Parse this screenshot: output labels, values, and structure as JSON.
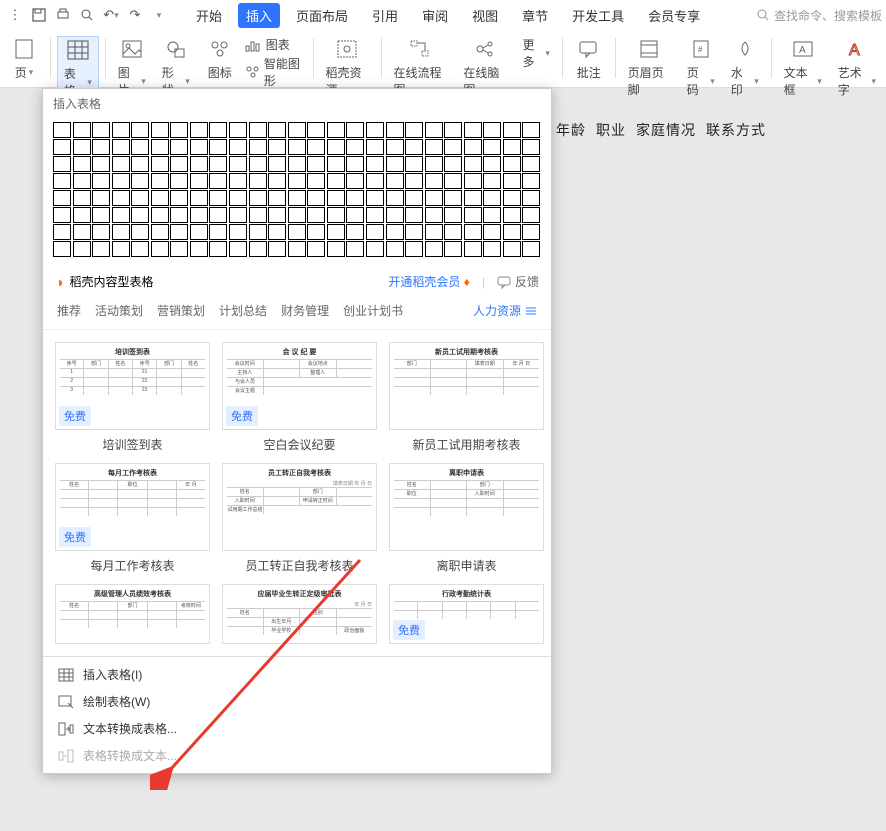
{
  "tabs": {
    "start": "开始",
    "insert": "插入",
    "layout": "页面布局",
    "ref": "引用",
    "review": "审阅",
    "view": "视图",
    "chapter": "章节",
    "dev": "开发工具",
    "member": "会员专享"
  },
  "search_placeholder": "查找命令、搜索模板",
  "ribbon": {
    "page_section": "页 ",
    "table": "表格",
    "picture": "图片",
    "shape": "形状",
    "icon": "图标",
    "chart": "图表",
    "smart": "智能图形",
    "docer_res": "稻壳资源",
    "flow": "在线流程图",
    "mind": "在线脑图",
    "more": "更多",
    "comment": "批注",
    "headerfooter": "页眉页脚",
    "pagenum": "页码",
    "watermark": "水印",
    "textbox": "文本框",
    "wordart": "艺术字"
  },
  "doc_header_cells": [
    "年龄",
    "职业",
    "家庭情况",
    "联系方式"
  ],
  "dropdown": {
    "header": "插入表格",
    "docer_label": "稻壳内容型表格",
    "open_member": "开通稻壳会员",
    "feedback": "反馈",
    "categories": [
      "推荐",
      "活动策划",
      "营销策划",
      "计划总结",
      "财务管理",
      "创业计划书"
    ],
    "cat_right": "人力资源",
    "free": "免费",
    "templates": {
      "r1c1": "培训签到表",
      "r1c2": "空白会议纪要",
      "r1c3": "新员工试用期考核表",
      "r2c1": "每月工作考核表",
      "r2c2": "员工转正自我考核表",
      "r2c3": "离职申请表",
      "r3c1_thumb": "高级管理人员绩效考核表",
      "r3c2_thumb": "应届毕业生转正定级审批表",
      "r3c3_thumb": "行政考勤统计表"
    },
    "thumb_labels": {
      "t1": "培训签到表",
      "t2": "会 议 纪 要",
      "t2_r1a": "会议时间",
      "t2_r1b": "会议地点",
      "t2_r2a": "主持人",
      "t2_r2b": "整理人",
      "t2_r3a": "与会人员",
      "t2_r4a": "会议主题",
      "t3": "新员工试用期考核表",
      "t4": "每月工作考核表",
      "t5": "员工转正自我考核表",
      "t6": "离职申请表"
    },
    "menu": {
      "insert_table": "插入表格(I)",
      "draw_table": "绘制表格(W)",
      "text_to_table": "文本转换成表格...",
      "table_to_text": "表格转换成文本..."
    }
  }
}
